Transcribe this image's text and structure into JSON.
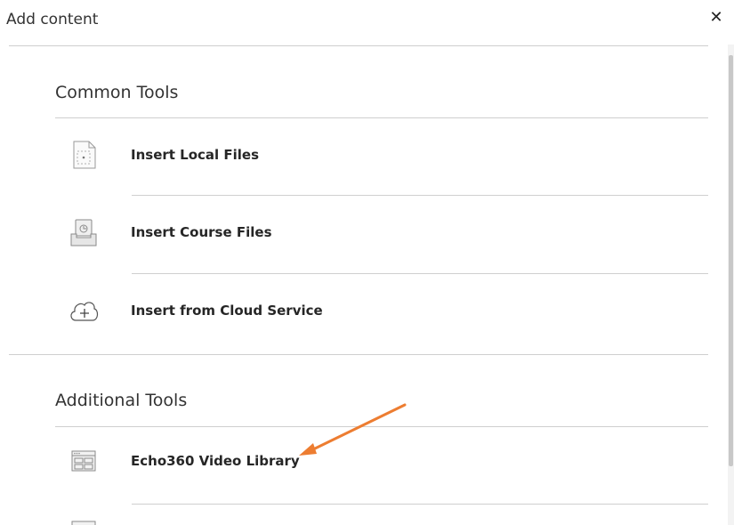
{
  "header": {
    "title": "Add content",
    "close_symbol": "✕"
  },
  "common_tools": {
    "title": "Common Tools",
    "items": [
      {
        "label": "Insert Local Files",
        "icon": "file-icon"
      },
      {
        "label": "Insert Course Files",
        "icon": "course-files-icon"
      },
      {
        "label": "Insert from Cloud Service",
        "icon": "cloud-icon"
      }
    ]
  },
  "additional_tools": {
    "title": "Additional Tools",
    "items": [
      {
        "label": "Echo360 Video Library",
        "icon": "video-library-icon"
      }
    ]
  },
  "colors": {
    "annotation_arrow": "#ED7D31",
    "divider": "#cfcfcf",
    "text": "#333333"
  }
}
